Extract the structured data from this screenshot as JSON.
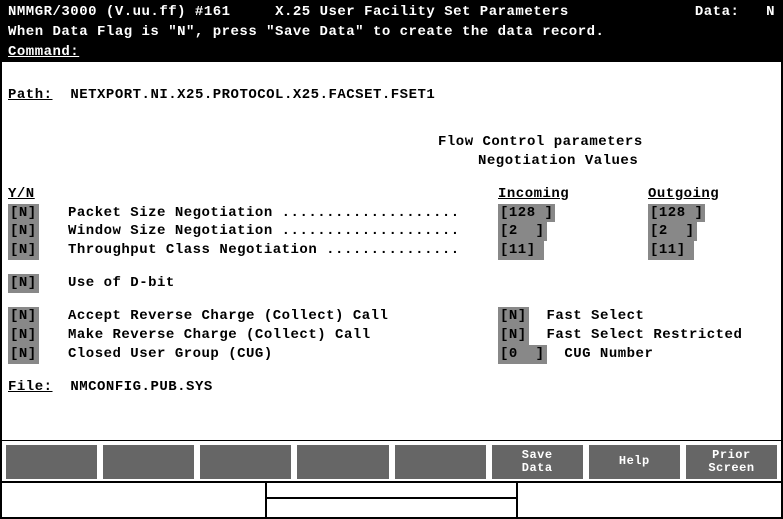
{
  "title": {
    "app": "NMMGR/3000 (V.uu.ff) #161",
    "screen_name": "X.25 User Facility Set Parameters",
    "data_label": "Data:",
    "data_value": "N"
  },
  "info_line": "When Data Flag is \"N\", press \"Save Data\" to create the data record.",
  "command_label": "Command:",
  "path_label": "Path:",
  "path_value": "NETXPORT.NI.X25.PROTOCOL.X25.FACSET.FSET1",
  "heading1": "Flow Control parameters",
  "heading2": "Negotiation Values",
  "col_yn": "Y/N",
  "col_incoming": "Incoming",
  "col_outgoing": "Outgoing",
  "rows_negotiation": [
    {
      "yn": "[N]",
      "label": "Packet Size Negotiation",
      "in": "[128 ]",
      "out": "[128 ]"
    },
    {
      "yn": "[N]",
      "label": "Window Size Negotiation",
      "in": "[2  ]",
      "out": "[2  ]"
    },
    {
      "yn": "[N]",
      "label": "Throughput Class Negotiation",
      "in": "[11]",
      "out": "[11]"
    }
  ],
  "dbit": {
    "yn": "[N]",
    "label": "Use of D-bit"
  },
  "rows_flags": [
    {
      "yn": "[N]",
      "label": "Accept Reverse Charge (Collect) Call",
      "right_yn": "[N]",
      "right_label": "Fast Select"
    },
    {
      "yn": "[N]",
      "label": "Make Reverse Charge (Collect) Call",
      "right_yn": "[N]",
      "right_label": "Fast Select Restricted"
    },
    {
      "yn": "[N]",
      "label": "Closed User Group (CUG)",
      "right_yn": "[0  ]",
      "right_label": "CUG Number"
    }
  ],
  "file_label": "File:",
  "file_value": "NMCONFIG.PUB.SYS",
  "fkeys": [
    "",
    "",
    "",
    "",
    "",
    "Save\nData",
    "Help",
    "Prior\nScreen"
  ]
}
